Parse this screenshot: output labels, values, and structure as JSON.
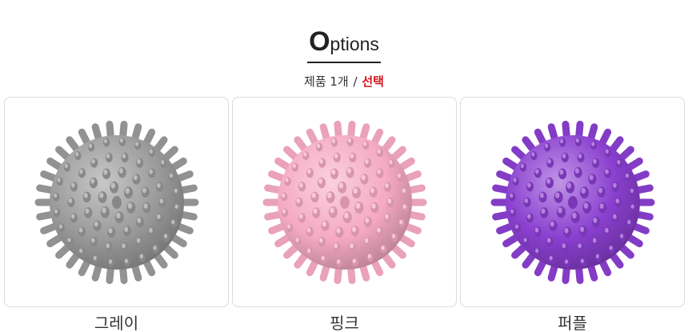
{
  "header": {
    "title_initial": "O",
    "title_rest": "ptions",
    "subtitle_prefix": "제품 1개",
    "subtitle_separator": "/",
    "subtitle_select": "선택",
    "select_color": "#d4151b"
  },
  "options": [
    {
      "label": "그레이",
      "image": "gray-spiky-massage-ball",
      "color": "#9a9a9a"
    },
    {
      "label": "핑크",
      "image": "pink-spiky-massage-ball",
      "color": "#f5aac2"
    },
    {
      "label": "퍼플",
      "image": "purple-spiky-massage-ball",
      "color": "#8a3fcf"
    }
  ]
}
